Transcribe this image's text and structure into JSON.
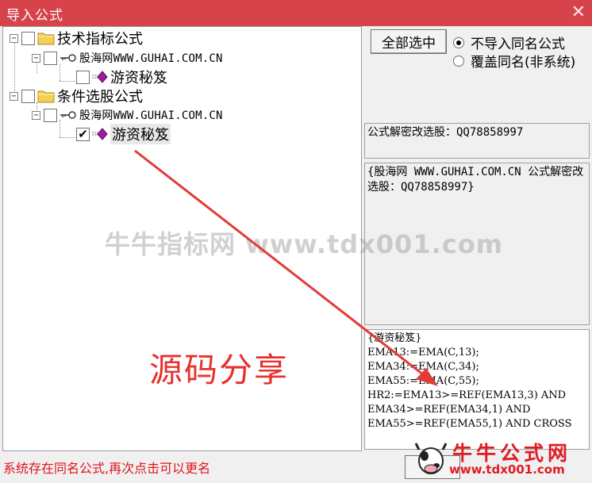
{
  "window": {
    "title": "导入公式",
    "close_glyph": "✕"
  },
  "tree": {
    "groups": [
      {
        "label": "技术指标公式",
        "checked": false,
        "source": "股海网WWW.GUHAI.COM.CN",
        "item": {
          "label": "游资秘笈",
          "checked": false
        }
      },
      {
        "label": "条件选股公式",
        "checked": false,
        "source": "股海网WWW.GUHAI.COM.CN",
        "item": {
          "label": "游资秘笈",
          "checked": true
        }
      }
    ]
  },
  "controls": {
    "select_all_label": "全部选中",
    "radio_no_import_label": "不导入同名公式",
    "radio_overwrite_label": "覆盖同名(非系统)",
    "selected_option": "不导入同名公式"
  },
  "info": {
    "contact": "公式解密改选股：QQ78858997",
    "description": "{股海网 WWW.GUHAI.COM.CN 公式解密改选股：QQ78858997}",
    "code": "{游资秘笈}\nEMA13:=EMA(C,13);\nEMA34:=EMA(C,34);\nEMA55:=EMA(C,55);\nHR2:=EMA13>=REF(EMA13,3) AND\nEMA34>=REF(EMA34,1) AND\nEMA55>=REF(EMA55,1) AND CROSS"
  },
  "status": {
    "text": "系统存在同名公式,再次点击可以更名"
  },
  "overlay": {
    "watermark": "牛牛指标网 www.tdx001.com",
    "annotation": "源码分享",
    "logo_title": "牛牛公式网",
    "logo_url": "www.tdx001.com"
  },
  "colors": {
    "titlebar": "#d7434a",
    "status_text": "#e0141b",
    "annotation": "#e8312f"
  },
  "icons": {
    "folder": "folder-icon",
    "key": "key-icon",
    "formula": "formula-diamond-icon"
  }
}
